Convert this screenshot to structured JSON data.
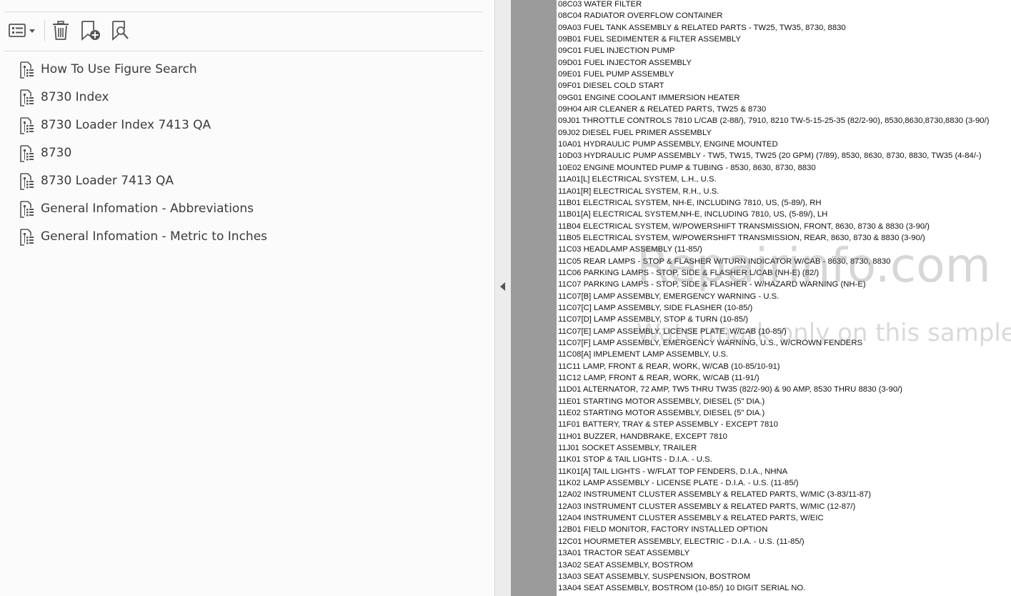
{
  "toolbar": {
    "options_icon": "list-options-icon",
    "delete_icon": "trash-icon",
    "new_bookmark_icon": "bookmark-add-icon",
    "find_bookmark_icon": "bookmark-find-icon"
  },
  "bookmarks": [
    {
      "label": "How To Use Figure Search"
    },
    {
      "label": "8730 Index"
    },
    {
      "label": "8730 Loader Index 7413 QA"
    },
    {
      "label": "8730"
    },
    {
      "label": "8730 Loader 7413 QA"
    },
    {
      "label": "General Infomation - Abbreviations"
    },
    {
      "label": "General Infomation - Metric to Inches"
    }
  ],
  "document": {
    "lines": [
      "08C03 WATER FILTER",
      "08C04 RADIATOR OVERFLOW CONTAINER",
      "09A03 FUEL TANK ASSEMBLY & RELATED PARTS - TW25, TW35, 8730, 8830",
      "09B01 FUEL SEDIMENTER & FILTER ASSEMBLY",
      "09C01 FUEL INJECTION PUMP",
      "09D01 FUEL INJECTOR ASSEMBLY",
      "09E01 FUEL PUMP ASSEMBLY",
      "09F01 DIESEL COLD START",
      "09G01 ENGINE COOLANT IMMERSION HEATER",
      "09H04 AIR CLEANER & RELATED PARTS, TW25 & 8730",
      "09J01 THROTTLE CONTROLS 7810 L/CAB (2-88/), 7910, 8210 TW-5-15-25-35 (82/2-90), 8530,8630,8730,8830 (3-90/)",
      "09J02 DIESEL FUEL PRIMER ASSEMBLY",
      "10A01 HYDRAULIC PUMP ASSEMBLY, ENGINE MOUNTED",
      "10D03 HYDRAULIC PUMP ASSEMBLY - TW5, TW15, TW25 (20 GPM) (7/89), 8530, 8630, 8730, 8830, TW35 (4-84/-)",
      "10E02 ENGINE MOUNTED PUMP & TUBING - 8530, 8630, 8730, 8830",
      "11A01[L] ELECTRICAL SYSTEM, L.H., U.S.",
      "11A01[R] ELECTRICAL SYSTEM, R.H., U.S.",
      "11B01 ELECTRICAL SYSTEM, NH-E, INCLUDING 7810, US, (5-89/), RH",
      "11B01[A] ELECTRICAL SYSTEM,NH-E, INCLUDING 7810, US, (5-89/), LH",
      "11B04 ELECTRICAL SYSTEM, W/POWERSHIFT TRANSMISSION, FRONT,  8630, 8730 & 8830 (3-90/)",
      "11B05 ELECTRICAL SYSTEM, W/POWERSHIFT TRANSMISSION, REAR, 8630, 8730 & 8830 (3-90/)",
      "11C03 HEADLAMP ASSEMBLY (11-85/)",
      "11C05 REAR LAMPS - STOP & FLASHER W/TURN INDICATOR W/CAB - 8630, 8730, 8830",
      "11C06 PARKING LAMPS - STOP, SIDE & FLASHER L/CAB (NH-E) (82/)",
      "11C07 PARKING LAMPS - STOP, SIDE & FLASHER - W/HAZARD WARNING (NH-E)",
      "11C07[B] LAMP ASSEMBLY, EMERGENCY WARNING - U.S.",
      "11C07[C] LAMP ASSEMBLY, SIDE FLASHER (10-85/)",
      "11C07[D] LAMP ASSEMBLY, STOP & TURN (10-85/)",
      "11C07[E] LAMP ASSEMBLY, LICENSE PLATE, W/CAB (10-85/)",
      "11C07[F] LAMP ASSEMBLY, EMERGENCY WARNING, U.S., W/CROWN FENDERS",
      "11C08[A] IMPLEMENT LAMP ASSEMBLY, U.S.",
      "11C11 LAMP, FRONT & REAR, WORK, W/CAB (10-85/10-91)",
      "11C12 LAMP, FRONT & REAR, WORK, W/CAB (11-91/)",
      "11D01 ALTERNATOR, 72 AMP, TW5 THRU TW35 (82/2-90) & 90 AMP, 8530 THRU 8830 (3-90/)",
      "11E01 STARTING MOTOR ASSEMBLY, DIESEL (5\" DIA.)",
      "11E02 STARTING MOTOR ASSEMBLY, DIESEL (5\" DIA.)",
      "11F01 BATTERY, TRAY & STEP ASSEMBLY - EXCEPT 7810",
      "11H01 BUZZER, HANDBRAKE, EXCEPT 7810",
      "11J01 SOCKET ASSEMBLY, TRAILER",
      "11K01 STOP & TAIL LIGHTS - D.I.A. - U.S.",
      "11K01[A] TAIL LIGHTS - W/FLAT TOP FENDERS, D.I.A., NHNA",
      "11K02 LAMP ASSEMBLY - LICENSE PLATE - D.I.A. - U.S. (11-85/)",
      "12A02 INSTRUMENT CLUSTER ASSEMBLY & RELATED PARTS, W/MIC (3-83/11-87)",
      "12A03 INSTRUMENT CLUSTER ASSEMBLY & RELATED PARTS, W/MIC (12-87/)",
      "12A04 INSTRUMENT CLUSTER ASSEMBLY & RELATED PARTS, W/EIC",
      "12B01 FIELD MONITOR, FACTORY INSTALLED OPTION",
      "12C01 HOURMETER ASSEMBLY, ELECTRIC - D.I.A. - U.S. (11-85/)",
      "13A01 TRACTOR SEAT ASSEMBLY",
      "13A02 SEAT ASSEMBLY, BOSTROM",
      "13A03 SEAT ASSEMBLY, SUSPENSION, BOSTROM",
      "13A04 SEAT ASSEMBLY, BOSTROM (10-85/) 10 DIGIT SERIAL NO."
    ],
    "watermark_main": "Repairinfo.com",
    "watermark_sub": "Watermark only on this sample"
  },
  "colors": {
    "panel_bg": "#fbfbfb",
    "bookmark_text": "#3c3c3c",
    "icon": "#555555",
    "splitter": "#ececec",
    "page_margin": "#9b9b9b"
  }
}
